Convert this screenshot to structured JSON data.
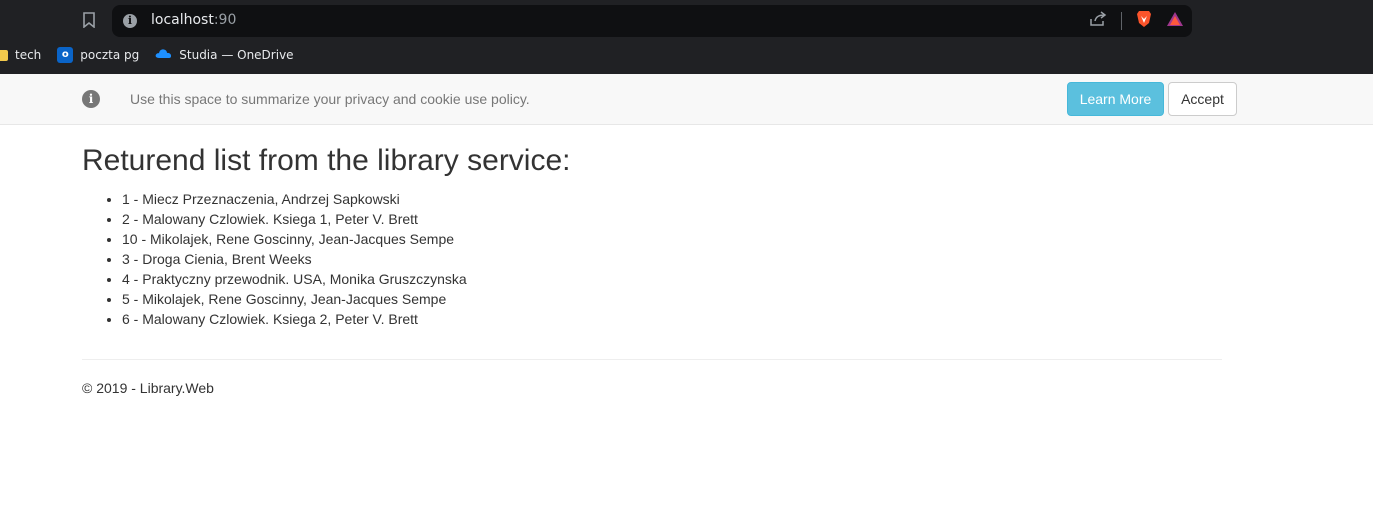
{
  "browser": {
    "url_host": "localhost",
    "url_port": ":90",
    "icons": [
      "bookmark-icon",
      "info-icon",
      "share-icon",
      "brave-shield-icon",
      "brave-rewards-icon"
    ],
    "bookmarks": [
      {
        "label": "tech",
        "icon": "folder-icon"
      },
      {
        "label": "poczta pg",
        "icon": "outlook-icon"
      },
      {
        "label": "Studia — OneDrive",
        "icon": "onedrive-icon"
      }
    ]
  },
  "cookie_banner": {
    "text": "Use this space to summarize your privacy and cookie use policy.",
    "learn_more_label": "Learn More",
    "accept_label": "Accept",
    "icon": "info-icon"
  },
  "main": {
    "heading": "Returend list from the library service:",
    "books": [
      "1 - Miecz Przeznaczenia, Andrzej Sapkowski",
      "2 - Malowany Czlowiek. Ksiega 1, Peter V. Brett",
      "10 - Mikolajek, Rene Goscinny, Jean-Jacques Sempe",
      "3 - Droga Cienia, Brent Weeks",
      "4 - Praktyczny przewodnik. USA, Monika Gruszczynska",
      "5 - Mikolajek, Rene Goscinny, Jean-Jacques Sempe",
      "6 - Malowany Czlowiek. Ksiega 2, Peter V. Brett"
    ]
  },
  "footer": {
    "text": "© 2019 - Library.Web"
  },
  "colors": {
    "chrome_bg": "#202124",
    "learn_more_bg": "#5bc0de",
    "cookie_bar_bg": "#f8f8f8"
  }
}
